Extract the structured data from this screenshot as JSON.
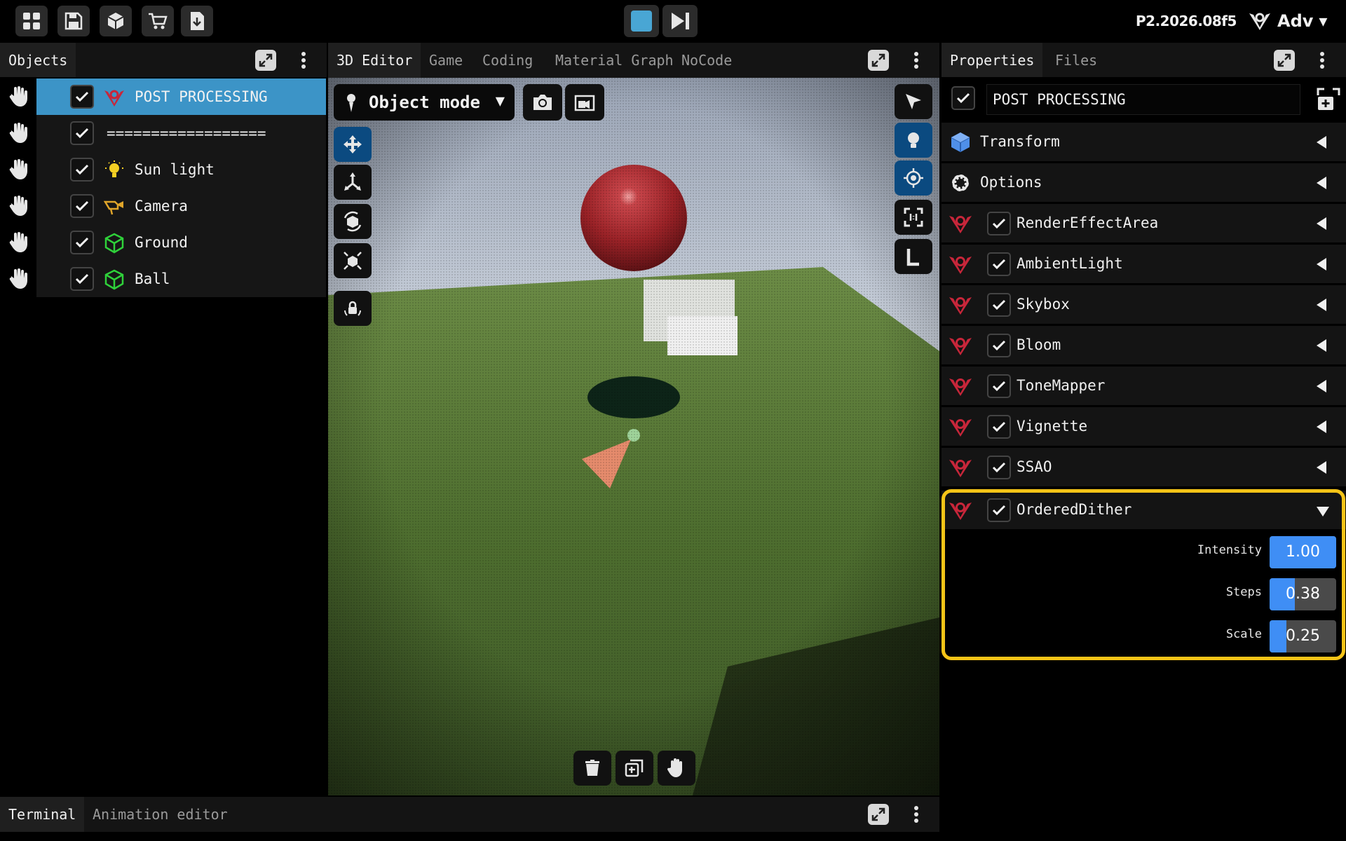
{
  "toolbar": {
    "icons": [
      "grid-icon",
      "save-icon",
      "cube-icon",
      "cart-icon",
      "download-icon"
    ],
    "version": "P2.2026.08f5",
    "mode_label": "Adv"
  },
  "objects_panel": {
    "tab": "Objects",
    "items": [
      {
        "name": "POST PROCESSING",
        "icon": "post-processing-icon",
        "checked": true,
        "selected": true
      },
      {
        "name": "==================",
        "icon": "",
        "checked": true,
        "selected": false
      },
      {
        "name": "Sun light",
        "icon": "light-bulb-icon",
        "checked": true,
        "selected": false
      },
      {
        "name": "Camera",
        "icon": "camera-icon",
        "checked": true,
        "selected": false
      },
      {
        "name": "Ground",
        "icon": "mesh-icon",
        "checked": true,
        "selected": false
      },
      {
        "name": "Ball",
        "icon": "mesh-icon",
        "checked": true,
        "selected": false
      }
    ]
  },
  "editor_tabs": [
    "3D Editor",
    "Game",
    "Coding",
    "Material Graph",
    "NoCode"
  ],
  "viewport": {
    "mode": "Object mode"
  },
  "properties_panel": {
    "tabs": [
      "Properties",
      "Files"
    ],
    "object_name": "POST PROCESSING",
    "sections": [
      {
        "name": "Transform",
        "icon": "transform-cube-icon"
      },
      {
        "name": "Options",
        "icon": "gear-icon"
      }
    ],
    "components": [
      {
        "name": "RenderEffectArea",
        "checked": true,
        "expanded": false
      },
      {
        "name": "AmbientLight",
        "checked": true,
        "expanded": false
      },
      {
        "name": "Skybox",
        "checked": true,
        "expanded": false
      },
      {
        "name": "Bloom",
        "checked": true,
        "expanded": false
      },
      {
        "name": "ToneMapper",
        "checked": true,
        "expanded": false
      },
      {
        "name": "Vignette",
        "checked": true,
        "expanded": false
      },
      {
        "name": "SSAO",
        "checked": true,
        "expanded": false
      },
      {
        "name": "OrderedDither",
        "checked": true,
        "expanded": true
      }
    ],
    "dither_params": [
      {
        "label": "Intensity",
        "value": "1.00",
        "fraction": 1.0
      },
      {
        "label": "Steps",
        "value": "0.38",
        "fraction": 0.38
      },
      {
        "label": "Scale",
        "value": "0.25",
        "fraction": 0.25
      }
    ]
  },
  "bottom_tabs": [
    "Terminal",
    "Animation editor"
  ],
  "colors": {
    "accent": "#3c94c7",
    "highlight": "#f5c417",
    "slider": "#3f8ef5"
  }
}
